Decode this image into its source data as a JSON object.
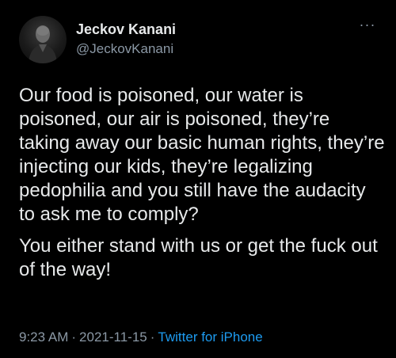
{
  "author": {
    "display_name": "Jeckov Kanani",
    "handle": "@JeckovKanani",
    "more_icon": "more-horizontal-icon"
  },
  "tweet": {
    "paragraphs": [
      "Our food is poisoned, our water is poisoned, our air is poisoned, they’re taking away our basic human rights, they’re injecting our kids, they’re legalizing pedophilia and you still have the audacity to ask me to comply?",
      "You either stand with us or get the fuck out of the way!"
    ],
    "time": "9:23 AM",
    "separator": "·",
    "date": "2021-11-15",
    "source": "Twitter for iPhone"
  },
  "colors": {
    "background": "#000000",
    "text": "#e7e9ea",
    "secondary": "#8b98a5",
    "link": "#1d9bf0"
  }
}
